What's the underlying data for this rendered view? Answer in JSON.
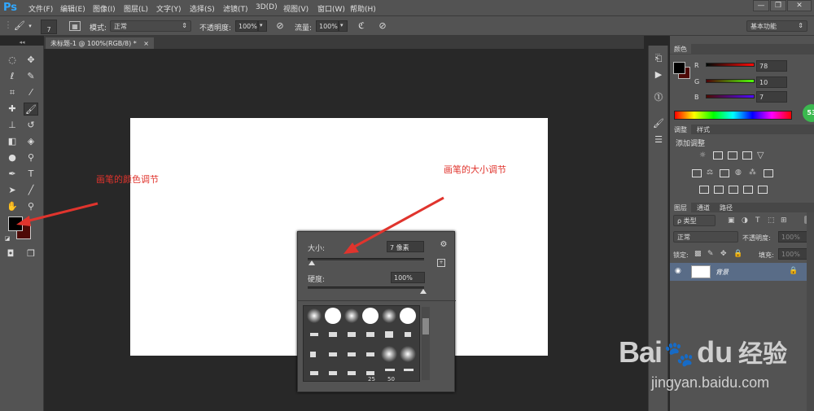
{
  "app": {
    "logo": "Ps"
  },
  "menubar": {
    "items": [
      "文件(F)",
      "编辑(E)",
      "图像(I)",
      "图层(L)",
      "文字(Y)",
      "选择(S)",
      "滤镜(T)",
      "3D(D)",
      "视图(V)",
      "窗口(W)",
      "帮助(H)"
    ],
    "window_controls": [
      "—",
      "❐",
      "✕"
    ]
  },
  "options": {
    "brush_size": "7",
    "mode_label": "模式:",
    "mode_value": "正常",
    "opacity_label": "不透明度:",
    "opacity_value": "100%",
    "flow_label": "流量:",
    "flow_value": "100%",
    "workspace": "基本功能"
  },
  "document": {
    "tab_title": "未标题-1 @ 100%(RGB/8) *",
    "close": "×"
  },
  "annotations": {
    "color_note": "画笔的颜色调节",
    "size_note": "画笔的大小调节"
  },
  "brush_popup": {
    "size_label": "大小:",
    "size_value": "7 像素",
    "hardness_label": "硬度:",
    "hardness_value": "100%",
    "preset_numbers": [
      "25",
      "50"
    ]
  },
  "color_panel": {
    "tabs": [
      "颜色"
    ],
    "r_label": "R",
    "r_value": "78",
    "g_label": "G",
    "g_value": "10",
    "b_label": "B",
    "b_value": "7",
    "badge": "53"
  },
  "adjust_panel": {
    "tabs": [
      "调整",
      "样式"
    ],
    "title": "添加调整"
  },
  "layers_panel": {
    "tabs": [
      "图层",
      "通道",
      "路径"
    ],
    "filter_label": "ρ 类型",
    "blend_mode": "正常",
    "opacity_label": "不透明度:",
    "opacity_value": "100%",
    "lock_label": "锁定:",
    "fill_label": "填充:",
    "fill_value": "100%",
    "layer_name": "背景"
  },
  "watermark": {
    "brand_left": "Bai",
    "brand_right": "du",
    "brand_cn": "经验",
    "url": "jingyan.baidu.com"
  },
  "colors": {
    "foreground": "#000000",
    "background": "#4e0a07",
    "annotation": "#e0342d",
    "accent": "#31a8ff"
  }
}
